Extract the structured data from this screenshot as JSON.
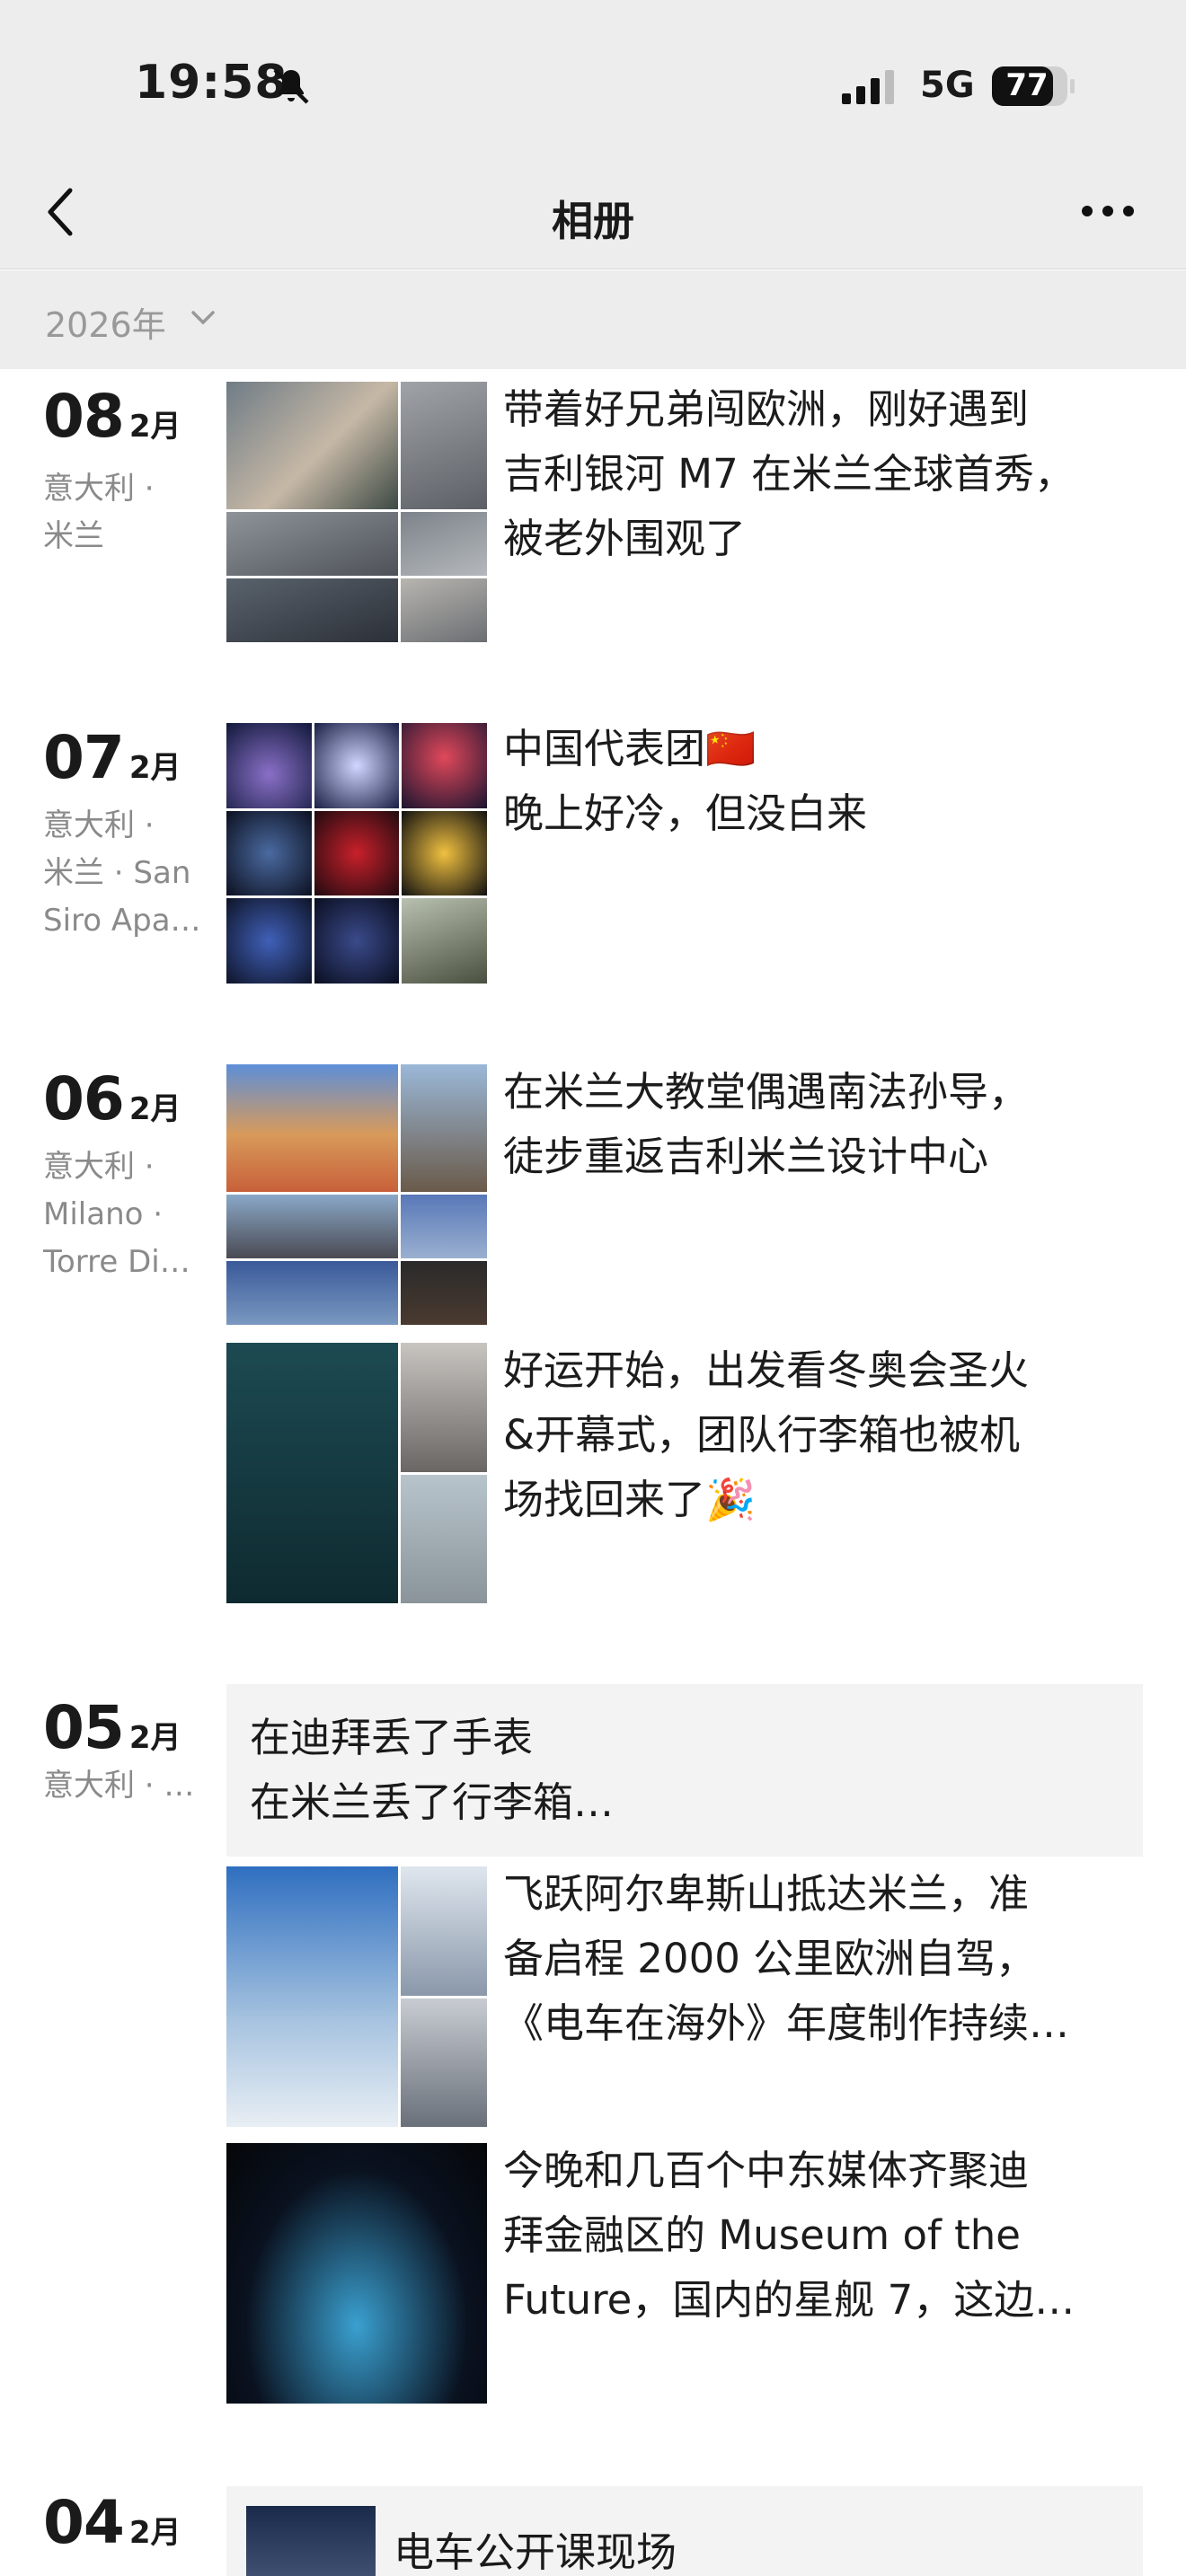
{
  "status": {
    "time": "19:58",
    "network": "5G",
    "battery": "77"
  },
  "nav": {
    "title": "相册"
  },
  "filter": {
    "year": "2026年"
  },
  "days": [
    {
      "day": "08",
      "month": "2月",
      "location": [
        "意大利 ·",
        "米兰"
      ],
      "posts": [
        {
          "lines": [
            "带着好兄弟闯欧洲，刚好遇到",
            "吉利银河 M7 在米兰全球首秀，",
            "被老外围观了"
          ]
        }
      ]
    },
    {
      "day": "07",
      "month": "2月",
      "location": [
        "意大利 ·",
        "米兰 · San",
        "Siro Apa…"
      ],
      "posts": [
        {
          "lines": [
            "中国代表团🇨🇳",
            "晚上好冷，但没白来"
          ]
        }
      ]
    },
    {
      "day": "06",
      "month": "2月",
      "location": [
        "意大利 ·",
        "Milano ·",
        "Torre Di…"
      ],
      "posts": [
        {
          "lines": [
            "在米兰大教堂偶遇南法孙导，",
            "徒步重返吉利米兰设计中心"
          ]
        },
        {
          "lines": [
            "好运开始，出发看冬奥会圣火",
            "&开幕式，团队行李箱也被机",
            "场找回来了🎉"
          ]
        }
      ]
    },
    {
      "day": "05",
      "month": "2月",
      "location": [
        "意大利 · …"
      ],
      "text_post": [
        "在迪拜丢了手表",
        "在米兰丢了行李箱…"
      ],
      "posts": [
        {
          "lines": [
            "飞跃阿尔卑斯山抵达米兰，准",
            "备启程 2000 公里欧洲自驾，",
            "《电车在海外》年度制作持续…"
          ]
        },
        {
          "lines": [
            "今晚和几百个中东媒体齐聚迪",
            "拜金融区的 Museum of the",
            "Future，国内的星舰 7，这边…"
          ]
        }
      ]
    },
    {
      "day": "04",
      "month": "2月",
      "posts": [
        {
          "lines": [
            "电车公开课现场"
          ]
        }
      ]
    }
  ],
  "colors": {
    "topbar": "#ededed",
    "muted": "#8a8a8a",
    "card": "#f3f3f3"
  }
}
